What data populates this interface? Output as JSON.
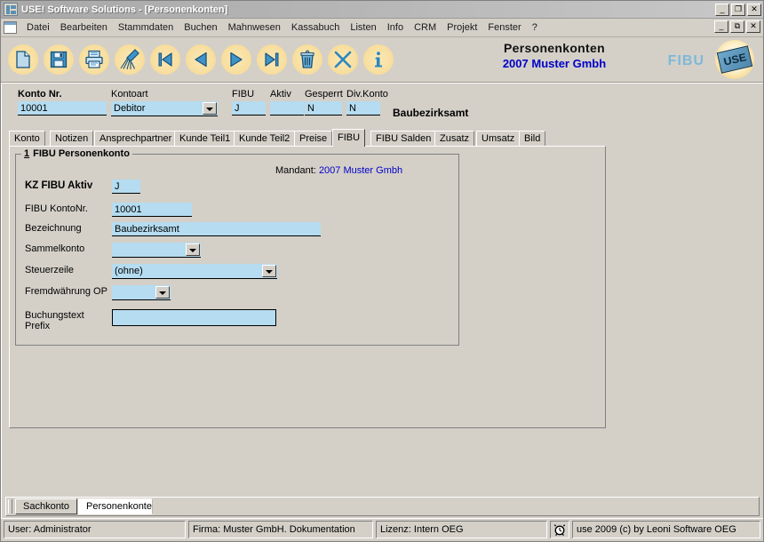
{
  "window": {
    "title": "USE! Software Solutions - [Personenkonten]",
    "app_icon": "use-logo-icon",
    "minimize": "_",
    "maximize": "❐",
    "close": "✕"
  },
  "menubar": {
    "mdi_icon": "document-window-icon",
    "items": [
      {
        "label": "Datei"
      },
      {
        "label": "Bearbeiten"
      },
      {
        "label": "Stammdaten"
      },
      {
        "label": "Buchen"
      },
      {
        "label": "Mahnwesen"
      },
      {
        "label": "Kassabuch"
      },
      {
        "label": "Listen"
      },
      {
        "label": "Info"
      },
      {
        "label": "CRM"
      },
      {
        "label": "Projekt"
      },
      {
        "label": "Fenster"
      },
      {
        "label": "?"
      }
    ],
    "mdi_minimize": "_",
    "mdi_restore": "⧉",
    "mdi_close": "✕"
  },
  "toolbar": {
    "buttons": [
      {
        "name": "new-icon",
        "label": "Neu"
      },
      {
        "name": "save-icon",
        "label": "Speichern"
      },
      {
        "name": "print-icon",
        "label": "Drucken"
      },
      {
        "name": "clear-broom-icon",
        "label": "Löschen/Leeren"
      },
      {
        "name": "first-record-icon",
        "label": "Erster Datensatz"
      },
      {
        "name": "previous-record-icon",
        "label": "Vorheriger Datensatz"
      },
      {
        "name": "next-record-icon",
        "label": "Nächster Datensatz"
      },
      {
        "name": "last-record-icon",
        "label": "Letzter Datensatz"
      },
      {
        "name": "delete-trash-icon",
        "label": "Löschen"
      },
      {
        "name": "cancel-x-icon",
        "label": "Abbrechen"
      },
      {
        "name": "info-icon",
        "label": "Info"
      }
    ]
  },
  "header": {
    "title": "Personenkonten",
    "subtitle": "2007 Muster Gmbh",
    "module_word": "FIBU",
    "logo_text": "USE"
  },
  "account_header": {
    "konto_nr": {
      "label": "Konto Nr.",
      "value": "10001"
    },
    "kontoart": {
      "label": "Kontoart",
      "value": "Debitor"
    },
    "fibu": {
      "label": "FIBU",
      "value": "J"
    },
    "aktiv": {
      "label": "Aktiv",
      "value": ""
    },
    "gesperrt": {
      "label": "Gesperrt",
      "value": "N"
    },
    "div_konto": {
      "label": "Div.Konto",
      "value": "N"
    },
    "account_name": "Baubezirksamt"
  },
  "tabs": {
    "items": [
      {
        "label": "Konto",
        "active": false
      },
      {
        "label": "Notizen",
        "active": false
      },
      {
        "label": "Ansprechpartner",
        "active": false
      },
      {
        "label": "Kunde Teil1",
        "active": false
      },
      {
        "label": "Kunde Teil2",
        "active": false
      },
      {
        "label": "Preise",
        "active": false
      },
      {
        "label": "FIBU",
        "active": true
      },
      {
        "label": "FIBU Salden",
        "active": false
      },
      {
        "label": "Zusatz",
        "active": false
      },
      {
        "label": "Umsatz",
        "active": false
      },
      {
        "label": "Bild",
        "active": false
      }
    ]
  },
  "fibu_panel": {
    "group_title_number": "1",
    "group_title": "FIBU Personenkonto",
    "mandant_label": "Mandant:",
    "mandant_value": "2007 Muster Gmbh",
    "fields": {
      "kz_fibu_aktiv": {
        "label": "KZ FIBU Aktiv",
        "value": "J"
      },
      "fibu_kontonr": {
        "label": "FIBU KontoNr.",
        "value": "10001"
      },
      "bezeichnung": {
        "label": "Bezeichnung",
        "value": "Baubezirksamt"
      },
      "sammelkonto": {
        "label": "Sammelkonto",
        "value": ""
      },
      "steuerzeile": {
        "label": "Steuerzeile",
        "value": "(ohne)"
      },
      "fremdwaehrung_op": {
        "label": "Fremdwährung OP",
        "value": ""
      },
      "buchungstext_prefix": {
        "label_line1": "Buchungstext",
        "label_line2": "Prefix",
        "value": ""
      }
    }
  },
  "bottom_tabs": {
    "items": [
      {
        "label": "Sachkonto",
        "selected": false
      },
      {
        "label": "Personenkonten",
        "selected": true
      }
    ]
  },
  "statusbar": {
    "user": "User: Administrator",
    "firma": "Firma: Muster GmbH. Dokumentation",
    "lizenz": "Lizenz: Intern OEG",
    "clock_icon": "alarm-clock-icon",
    "copyright": "use 2009 (c) by Leoni Software OEG"
  },
  "colors": {
    "field_blue": "#b5dcf0",
    "face": "#d4d0c8",
    "accent_blue": "#0000c8",
    "toolbar_disc": "#f8dfa0"
  }
}
